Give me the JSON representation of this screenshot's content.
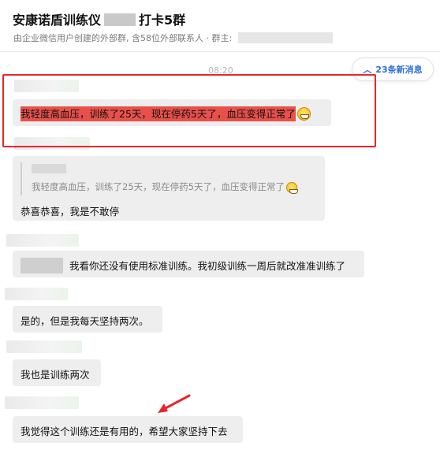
{
  "header": {
    "title_prefix": "安康诺盾训练仪",
    "title_suffix": "打卡5群",
    "subtitle": "由企业微信用户创建的外部群, 含58位外部联系人 · 群主:"
  },
  "chat": {
    "time": "08:20",
    "new_messages_label": "23条新消息",
    "messages": [
      {
        "text": "我轻度高血压，训练了25天，现在停药5天了，血压变得正常了"
      },
      {
        "quote": "我轻度高血压，训练了25天，现在停药5天了，血压变得正常了",
        "text": "恭喜恭喜，我是不敢停"
      },
      {
        "text": "我看你还没有使用标准训练。我初级训练一周后就改准准训练了"
      },
      {
        "text": "是的，但是我每天坚持两次。"
      },
      {
        "text": "我也是训练两次"
      },
      {
        "text": "我觉得这个训练还是有用的，希望大家坚持下去"
      }
    ]
  },
  "colors": {
    "highlight": "#e9504a",
    "annotation_red": "#e8262b",
    "link_blue": "#2f6fd6",
    "bubble_bg": "#eeeeee"
  },
  "icons": {
    "new_messages": "chevron-up-icon",
    "emoji": "grinning-emoji-icon",
    "annotation": "red-arrow-icon"
  }
}
